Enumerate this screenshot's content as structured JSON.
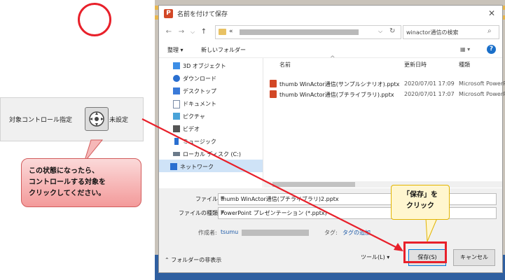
{
  "dialog": {
    "app_icon_letter": "P",
    "title": "名前を付けて保存",
    "close": "✕",
    "nav": {
      "back": "←",
      "forward": "→",
      "dropdown": "⌵",
      "up": "↑"
    },
    "address_prefix": "«",
    "address_chevron": "⌵",
    "refresh": "↻",
    "search_placeholder": "winactor通信の検索",
    "search_icon": "⌕",
    "toolbar": {
      "organize": "整理 ▾",
      "new_folder": "新しいフォルダー",
      "view": "▦ ▾",
      "help": "?"
    },
    "nav_items": [
      {
        "label": "3D オブジェクト",
        "icon": "cube-icon",
        "color": "#3d8ee6"
      },
      {
        "label": "ダウンロード",
        "icon": "download-icon",
        "color": "#2a6fd0"
      },
      {
        "label": "デスクトップ",
        "icon": "desktop-icon",
        "color": "#3a7ad8"
      },
      {
        "label": "ドキュメント",
        "icon": "document-icon",
        "color": "#7a8ca6"
      },
      {
        "label": "ピクチャ",
        "icon": "pictures-icon",
        "color": "#4aa3d8"
      },
      {
        "label": "ビデオ",
        "icon": "video-icon",
        "color": "#555555"
      },
      {
        "label": "ミュージック",
        "icon": "music-icon",
        "color": "#2a6fd0"
      },
      {
        "label": "ローカル ディスク (C:)",
        "icon": "drive-icon",
        "color": "#6b7a8a"
      },
      {
        "label": "ネットワーク",
        "icon": "network-icon",
        "color": "#2a6fd0"
      }
    ],
    "columns": {
      "name": "名前",
      "date": "更新日時",
      "type": "種類",
      "sort_caret": "^"
    },
    "files": [
      {
        "name": "thumb WinActor通信(サンプルシナリオ).pptx",
        "date": "2020/07/01 17:09",
        "type": "Microsoft PowerP"
      },
      {
        "name": "thumb WinActor通信(ブチライブラリ).pptx",
        "date": "2020/07/01 17:07",
        "type": "Microsoft PowerP"
      }
    ],
    "filename_label": "ファイル名(N):",
    "filename_value": "thumb WinActor通信(プチライブラリ)2.pptx",
    "filetype_label": "ファイルの種類(T):",
    "filetype_value": "PowerPoint プレゼンテーション (*.pptx)",
    "author_label": "作成者:",
    "author_value": "tsumu",
    "tag_label": "タグ:",
    "tag_value": "タグの追加",
    "hide_folders": "フォルダーの非表示",
    "hide_folders_caret": "⌃",
    "tools": "ツール(L)",
    "tools_caret": "▾",
    "save": "保存(S)",
    "cancel": "キャンセル"
  },
  "control": {
    "label": "対象コントロール指定",
    "unset": "未設定"
  },
  "callouts": {
    "left_lines": [
      "この状態になったら、",
      "コントロールする対象を",
      "クリックしてください。"
    ],
    "right_lines": [
      "「保存」を",
      "クリック"
    ]
  },
  "colors": {
    "accent_red": "#e8202a",
    "link_blue": "#1c5aa8",
    "callout_pink": "#f39a9a",
    "callout_yellow": "#fff6cf"
  }
}
